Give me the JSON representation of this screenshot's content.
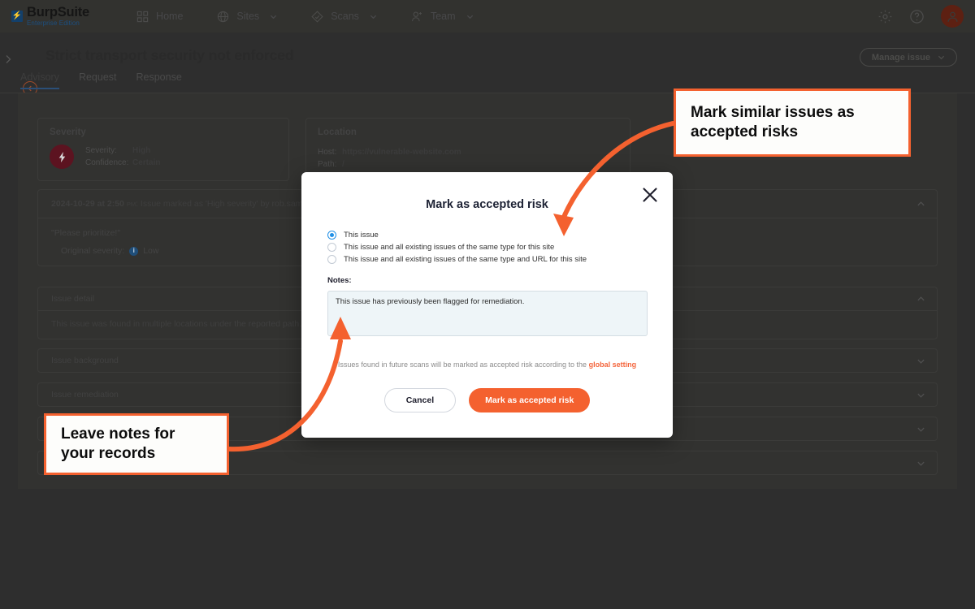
{
  "topnav": {
    "logo": {
      "title": "BurpSuite",
      "subtitle": "Enterprise Edition",
      "mark": "burp-logo-icon"
    },
    "items": [
      {
        "label": "Home",
        "icon": "grid-icon",
        "has_chevron": false
      },
      {
        "label": "Sites",
        "icon": "globe-icon",
        "has_chevron": true
      },
      {
        "label": "Scans",
        "icon": "scan-diamond-icon",
        "has_chevron": true
      },
      {
        "label": "Team",
        "icon": "person-add-icon",
        "has_chevron": true
      }
    ],
    "right": [
      {
        "name": "settings-gear-icon"
      },
      {
        "name": "help-question-icon"
      },
      {
        "name": "user-avatar"
      }
    ]
  },
  "page": {
    "title": "Strict transport security not enforced",
    "back_icon": "back-arrow-circle-icon",
    "collapse_icon": "chevron-right-icon",
    "manage_button": "Manage issue",
    "tabs": [
      {
        "label": "Advisory",
        "active": true
      },
      {
        "label": "Request",
        "active": false
      },
      {
        "label": "Response",
        "active": false
      }
    ]
  },
  "severity_panel": {
    "title": "Severity",
    "icon": "severity-bolt-icon",
    "rows": [
      {
        "key": "Severity:",
        "value": "High"
      },
      {
        "key": "Confidence:",
        "value": "Certain"
      }
    ]
  },
  "location_panel": {
    "title": "Location",
    "rows": [
      {
        "key": "Host:",
        "value": "https://vulnerable-website.com"
      },
      {
        "key": "Path:",
        "value": "/"
      }
    ]
  },
  "history": {
    "timestamp": "2024-10-29 at 2:50",
    "meridiem": "PM",
    "entry": ": Issue marked as 'High severity' by rob.samuels@",
    "quote": "\"Please prioritize!\"",
    "original_severity_label": "Original severity:",
    "original_severity_value": "Low",
    "collapse_icon": "chevron-up-icon"
  },
  "accordions": [
    {
      "title": "Issue detail",
      "body": "This issue was found in multiple locations under the reported path.",
      "expanded": true,
      "icon": "chevron-up-icon"
    },
    {
      "title": "Issue background",
      "body": "",
      "expanded": false,
      "icon": "chevron-down-icon"
    },
    {
      "title": "Issue remediation",
      "body": "",
      "expanded": false,
      "icon": "chevron-down-icon"
    },
    {
      "title": "",
      "body": "",
      "expanded": false,
      "icon": "chevron-down-icon"
    },
    {
      "title": "",
      "body": "",
      "expanded": false,
      "icon": "chevron-down-icon"
    }
  ],
  "modal": {
    "title": "Mark as accepted risk",
    "close_icon": "close-x-icon",
    "options": [
      {
        "label": "This issue",
        "selected": true
      },
      {
        "label": "This issue and all existing issues of the same type for this site",
        "selected": false
      },
      {
        "label": "This issue and all existing issues of the same type and URL for this site",
        "selected": false
      }
    ],
    "notes_label": "Notes:",
    "notes_value": "This issue has previously been flagged for remediation.",
    "notes_placeholder": "",
    "future_note_text": "Issues found in future scans will be marked as accepted risk according to the ",
    "future_note_link": "global setting",
    "cancel_label": "Cancel",
    "confirm_label": "Mark as accepted risk"
  },
  "annotations": [
    {
      "name": "callout-mark-similar",
      "text": "Mark similar issues as accepted risks"
    },
    {
      "name": "callout-leave-notes",
      "text": "Leave notes for your records"
    }
  ],
  "colors": {
    "accent_orange": "#f4612f",
    "app_background": "#2e2e2e",
    "panel_background": "#323230",
    "modal_background": "#ffffff",
    "radio_blue": "#1f8fe5",
    "severity_red": "#5c1320",
    "notes_background": "#eef5f8"
  }
}
